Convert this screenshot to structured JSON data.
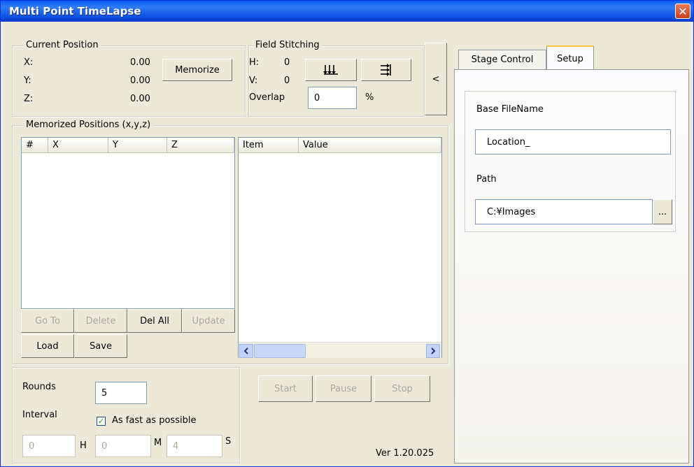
{
  "window": {
    "title": "Multi Point TimeLapse",
    "close_icon": "✕"
  },
  "current_position": {
    "legend": "Current Position",
    "x_label": "X:",
    "x_value": "0.00",
    "y_label": "Y:",
    "y_value": "0.00",
    "z_label": "Z:",
    "z_value": "0.00",
    "memorize_label": "Memorize"
  },
  "field_stitching": {
    "legend": "Field Stitching",
    "h_label": "H:",
    "h_value": "0",
    "v_label": "V:",
    "v_value": "0",
    "overlap_label": "Overlap",
    "overlap_value": "0",
    "percent_label": "%"
  },
  "collapse_label": "<",
  "memorized": {
    "legend": "Memorized Positions (x,y,z)",
    "columns": [
      "#",
      "X",
      "Y",
      "Z"
    ],
    "detail_columns": [
      "Item",
      "Value"
    ],
    "buttons": {
      "goto": "Go To",
      "delete": "Delete",
      "delall": "Del All",
      "update": "Update",
      "load": "Load",
      "save": "Save"
    }
  },
  "rounds": {
    "label": "Rounds",
    "value": "5"
  },
  "interval": {
    "label": "Interval",
    "as_fast_label": "As fast as possible",
    "as_fast_checked": true,
    "hours": "0",
    "h_unit": "H",
    "minutes": "0",
    "m_unit": "M",
    "seconds": "4",
    "s_unit": "S"
  },
  "actions": {
    "start": "Start",
    "pause": "Pause",
    "stop": "Stop"
  },
  "version": "Ver 1.20.025",
  "tabs": {
    "stage_control": "Stage Control",
    "setup": "Setup"
  },
  "setup": {
    "base_filename_label": "Base FileName",
    "base_filename_value": "Location_",
    "path_label": "Path",
    "path_value": "C:¥Images",
    "browse_label": "..."
  }
}
